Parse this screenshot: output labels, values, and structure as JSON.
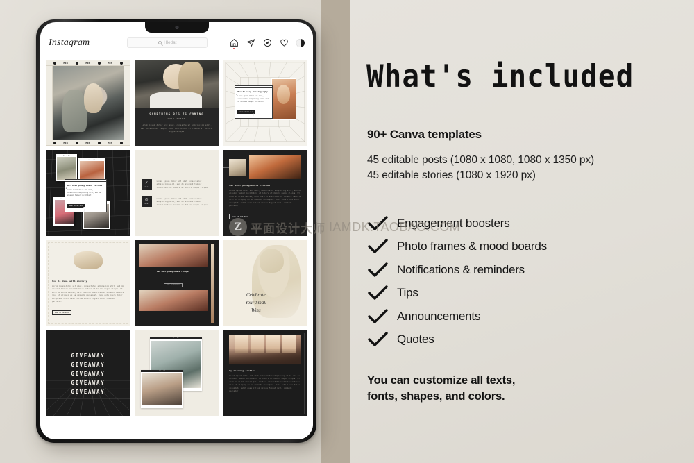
{
  "background": {
    "left_color": "#ddd9d1",
    "strip_color": "#b5ab9b",
    "right_color": "#e4e1da"
  },
  "device": {
    "name": "tablet-mockup",
    "frame_color": "#1a1a1a"
  },
  "instagram": {
    "logo": "Instagram",
    "search": {
      "placeholder": "Hledat",
      "value": ""
    },
    "nav_icons": [
      "home-icon",
      "send-icon",
      "explore-icon",
      "heart-icon",
      "profile-avatar"
    ]
  },
  "grid": {
    "posts": [
      {
        "id": "post-film-strip",
        "type": "film-strip-photo",
        "strip_label": "MDN",
        "sprockets": 4
      },
      {
        "id": "post-something-big",
        "type": "photo-with-dark-caption",
        "title": "SOMETHING BIG IS COMING",
        "subtitle": "STAY TUNED",
        "body": "Lorem ipsum dolor sit amet, consectetur adipiscing elit, sed do eiusmod tempor duis incididunt ut labore et dolore magna aliqua"
      },
      {
        "id": "post-how-to-stop",
        "type": "3d-room-popup",
        "popup_title": "How to stop feeling ugly",
        "popup_body": "Lorem ipsum dolor sit amet, consectetur adipiscing elit, sed do eiusmod tempor incididunt",
        "popup_button": "READ ON THE BLOG",
        "window_dot": "o"
      },
      {
        "id": "post-mood-board",
        "type": "dark-grid-mood-board",
        "popup_title": "Our best pomegranate recipes",
        "popup_body": "Lorem ipsum dolor sit amet, consectetur adipiscing elit, sed do eiusmod tempor incididunt",
        "popup_button": "READ ON THE BLOG",
        "photo_labels": [
          "01 . 04",
          "02 . 04",
          "03 . 04",
          "04 . 04"
        ]
      },
      {
        "id": "post-notification-list",
        "type": "cream-checklist-tiles",
        "tiles": [
          {
            "glyph": "check-icon",
            "label": "MDN",
            "text": "Lorem ipsum dolor sit amet consectetur adipiscing elit, sed do eiusmod tempor incididunt ut labore et dolore magna aliqua"
          },
          {
            "glyph": "ban-icon",
            "label": "MDN",
            "text": "Lorem ipsum dolor sit amet consectetur adipiscing elit, sed do eiusmod tempor incididunt ut labore et dolore magna aliqua"
          }
        ]
      },
      {
        "id": "post-pomegranate-dark",
        "type": "dark-article",
        "title": "Our best pomegranate recipes",
        "body": "Lorem ipsum dolor sit amet, consectetur adipiscing elit, sed do eiusmod tempor incididunt ut labore et dolore magna aliqua. Ut enim ad minim veniam, quis nostrud exercitation ullamco laboris nisi ut aliquip ex ea commodo consequat. Duis aute irure dolor voluptate velit esse cillum dolore fugiat nulla commodo pariatur.",
        "button": "READ ON THE BLOG"
      },
      {
        "id": "post-anxiety",
        "type": "cream-article",
        "title": "How to deal with anxiety",
        "body": "Lorem ipsum dolor sit amet, consectetur adipiscing elit, sed do eiusmod tempor incididunt ut labore et dolore magna aliqua. Ut enim ad minim veniam, quis nostrud exercitation ullamco laboris nisi ut aliquip ex ea commodo consequat. Duis aute irure dolor voluptate velit esse cillum dolore fugiat nulla commodo pariatur.",
        "button": "READ ON THE BLOG"
      },
      {
        "id": "post-pomegranate-story",
        "type": "dark-story-card",
        "title": "Our best pomegranate recipes",
        "button": "READ ON THE BLOG"
      },
      {
        "id": "post-celebrate",
        "type": "statue-quote",
        "lines": [
          "Celebrate",
          "Your Small",
          "Wins"
        ]
      },
      {
        "id": "post-giveaway",
        "type": "giveaway-repeat",
        "lines": [
          "GIVEAWAY",
          "GIVEAWAY",
          "GIVEAWAY",
          "GIVEAWAY",
          "GIVEAWAY"
        ]
      },
      {
        "id": "post-collage",
        "type": "cream-photo-collage",
        "photo_labels": [
          "01 . 02",
          "02 . 02"
        ]
      },
      {
        "id": "post-morning-routine",
        "type": "dark-article",
        "title": "My morning routine",
        "body": "Lorem ipsum dolor sit amet consectetur adipiscing elit, sed do eiusmod tempor incididunt ut labore et dolore magna aliqua. Ut enim ad minim veniam quis nostrud exercitation ullamco laboris nisi ut aliquip ex ea commodo consequat. Duis aute irure dolor voluptate velit esse cillum dolore fugiat nulla commodo pariatur."
      }
    ]
  },
  "panel": {
    "headline": "What's included",
    "subtitle_bold": "90+ Canva templates",
    "sub_lines": [
      "45 editable posts (1080 x 1080, 1080 x 1350 px)",
      "45 editable stories (1080 x 1920 px)"
    ],
    "checklist": [
      "Engagement boosters",
      "Photo frames & mood boards",
      "Notifications & reminders",
      "Tips",
      "Announcements",
      "Quotes"
    ],
    "footer_lines": [
      "You can customize all texts,",
      "fonts, shapes, and colors."
    ]
  },
  "watermark": {
    "logo_letter": "Z",
    "cn_text": "平面设计大师",
    "url": "IAMDK.TAOBAO.COM"
  }
}
